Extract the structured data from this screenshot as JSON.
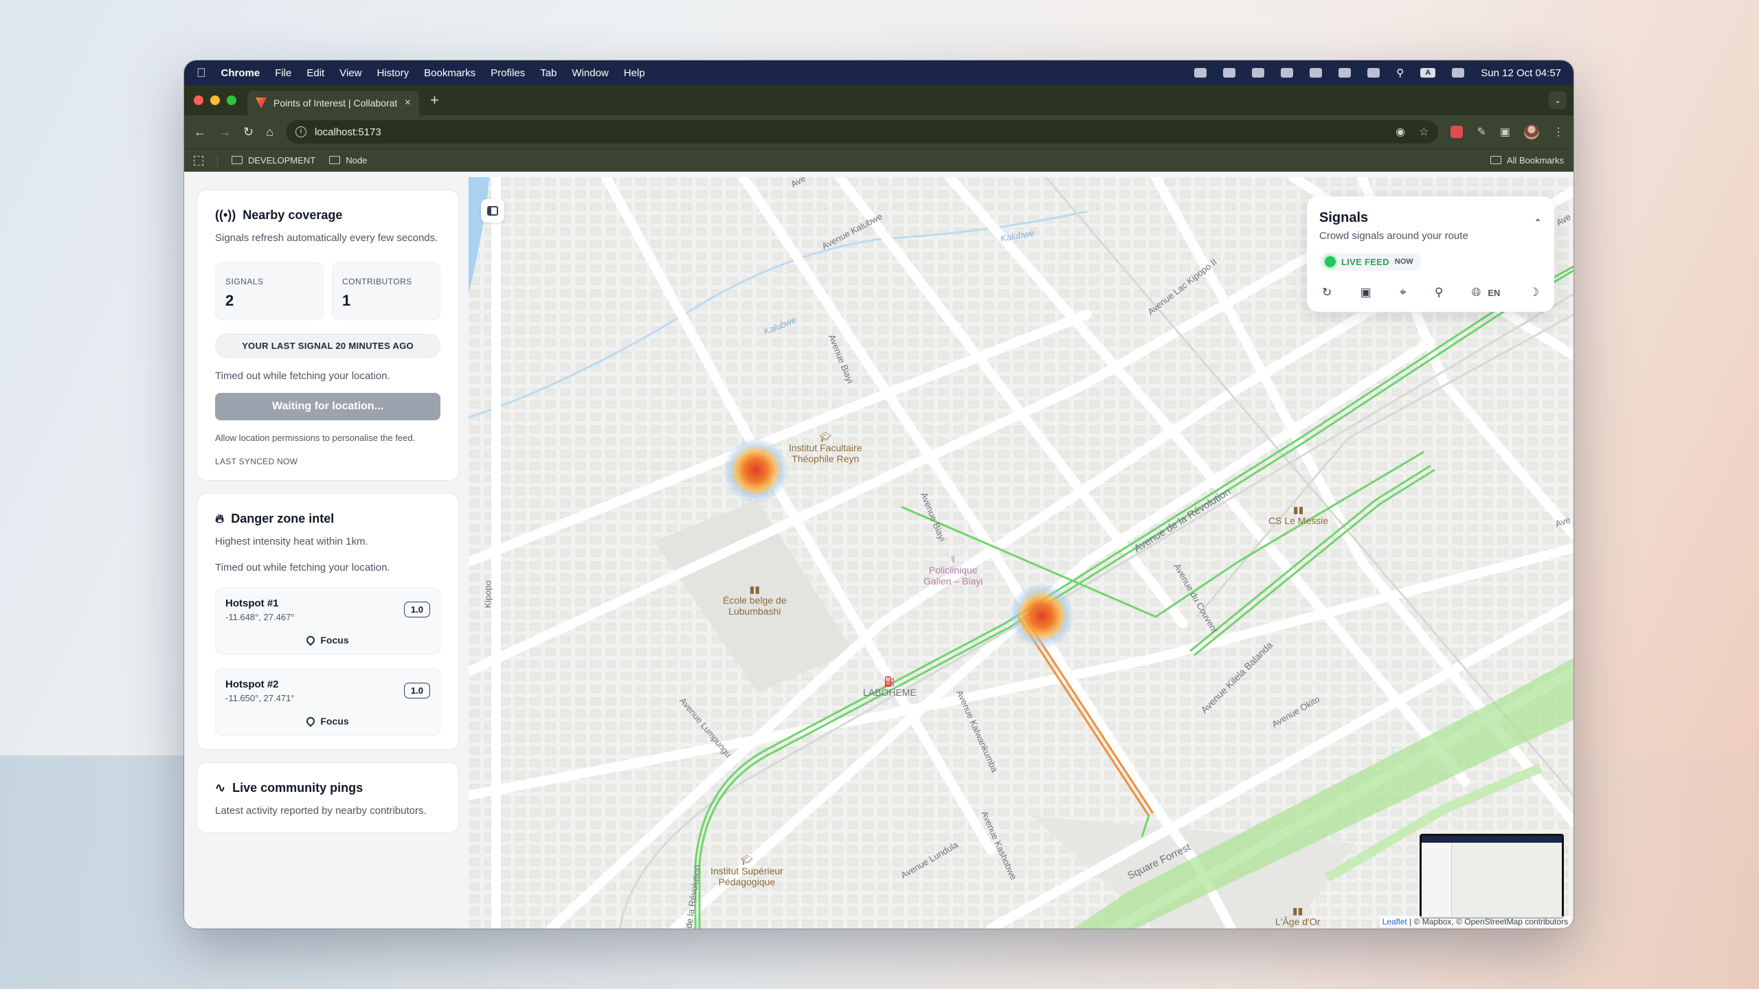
{
  "menubar": {
    "app": "Chrome",
    "items": [
      "File",
      "Edit",
      "View",
      "History",
      "Bookmarks",
      "Profiles",
      "Tab",
      "Window",
      "Help"
    ],
    "clock": "Sun 12 Oct  04:57",
    "input_badge": "A"
  },
  "browser": {
    "tab_title": "Points of Interest | Collaborat",
    "url": "localhost:5173",
    "bookmarks": [
      "DEVELOPMENT",
      "Node"
    ],
    "all_bookmarks": "All Bookmarks"
  },
  "sidebar": {
    "coverage": {
      "title": "Nearby coverage",
      "desc": "Signals refresh automatically every few seconds.",
      "signals_label": "SIGNALS",
      "signals_value": "2",
      "contributors_label": "CONTRIBUTORS",
      "contributors_value": "1",
      "last_signal": "YOUR LAST SIGNAL 20 MINUTES AGO",
      "timeout": "Timed out while fetching your location.",
      "button": "Waiting for location...",
      "permissions": "Allow location permissions to personalise the feed.",
      "synced": "LAST SYNCED NOW"
    },
    "danger": {
      "title": "Danger zone intel",
      "desc": "Highest intensity heat within 1km.",
      "timeout": "Timed out while fetching your location.",
      "hotspots": [
        {
          "name": "Hotspot #1",
          "coord": "-11.648°, 27.467°",
          "score": "1.0",
          "action": "Focus"
        },
        {
          "name": "Hotspot #2",
          "coord": "-11.650°, 27.471°",
          "score": "1.0",
          "action": "Focus"
        }
      ]
    },
    "pings": {
      "title": "Live community pings",
      "desc": "Latest activity reported by nearby contributors."
    }
  },
  "signals_panel": {
    "title": "Signals",
    "subtitle": "Crowd signals around your route",
    "live": "LIVE FEED",
    "live_time": "NOW",
    "lang": "EN"
  },
  "map": {
    "streets": [
      "Avenue Kalubwe",
      "Avenue Biayi",
      "Avenue Biayi",
      "Avenue Lac Kipopo II",
      "Avenue de la Révolution",
      "Avenue du Couvent",
      "Avenue Kilela Balanda",
      "Avenue Okito",
      "Avenue Lumpungu",
      "Avenue Kalwankumba",
      "Avenue Kashobwe",
      "Avenue Lundula",
      "Square Forrest",
      "de la Révolution",
      "Kipopo",
      "Ave",
      "Ave",
      "Ave"
    ],
    "water_labels": [
      "Kalubwe",
      "Kalubwe"
    ],
    "pois": [
      {
        "name": "Institut Facultaire\nThéophile Reyn"
      },
      {
        "name": "École belge de\nLubumbashi"
      },
      {
        "name": "Policlinique\nGalien – Biayi"
      },
      {
        "name": "CS Le Messie"
      },
      {
        "name": "LABOHEME"
      },
      {
        "name": "Institut Supérieur\nPédagogique"
      },
      {
        "name": "L'Âge d'Or"
      }
    ],
    "attribution_leaflet": "Leaflet",
    "attribution_rest": "| © Mapbox, © OpenStreetMap contributors"
  }
}
